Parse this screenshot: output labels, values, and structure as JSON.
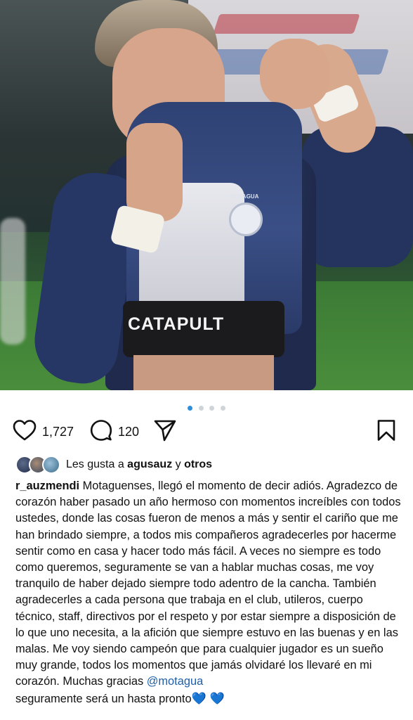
{
  "post": {
    "photo_print": "CATAPULT",
    "crest_label": "MOTAGUA",
    "pagination": {
      "total": 4,
      "active": 1
    },
    "actions": {
      "like_count": "1,727",
      "comment_count": "120"
    },
    "likes": {
      "prefix": "Les gusta a ",
      "user": "agusauz",
      "connector": " y ",
      "others": "otros"
    },
    "caption": {
      "username": "r_auzmendi",
      "text": " Motaguenses, llegó el momento de decir adiós. Agradezco de corazón haber pasado un año hermoso con momentos increíbles con todos ustedes, donde las cosas fueron de menos a más y sentir el cariño que me han brindado siempre, a todos mis compañeros agradecerles por hacerme sentir como en casa y hacer todo más fácil. A veces no siempre es todo como queremos, seguramente se van a hablar muchas cosas, me voy tranquilo de haber dejado siempre todo adentro de la cancha. También agradecerles a cada persona que trabaja en el club, utileros, cuerpo técnico, staff, directivos por el respeto y por estar siempre a disposición de lo que uno necesita, a la afición que siempre estuvo en las buenas y en las malas. Me voy siendo campeón que para cualquier jugador es un sueño muy grande, todos los momentos que jamás olvidaré los llevaré en mi corazón. Muchas gracias ",
      "mention": "@motagua",
      "closing": "seguramente será un hasta pronto",
      "hearts": "💙 💙"
    },
    "icons": {
      "like": "heart-icon",
      "comment": "comment-icon",
      "share": "send-icon",
      "save": "bookmark-icon"
    },
    "colors": {
      "mention": "#1f5fa8",
      "dot_active": "#2f8fd8",
      "dot_inactive": "#cfd4d8"
    }
  }
}
